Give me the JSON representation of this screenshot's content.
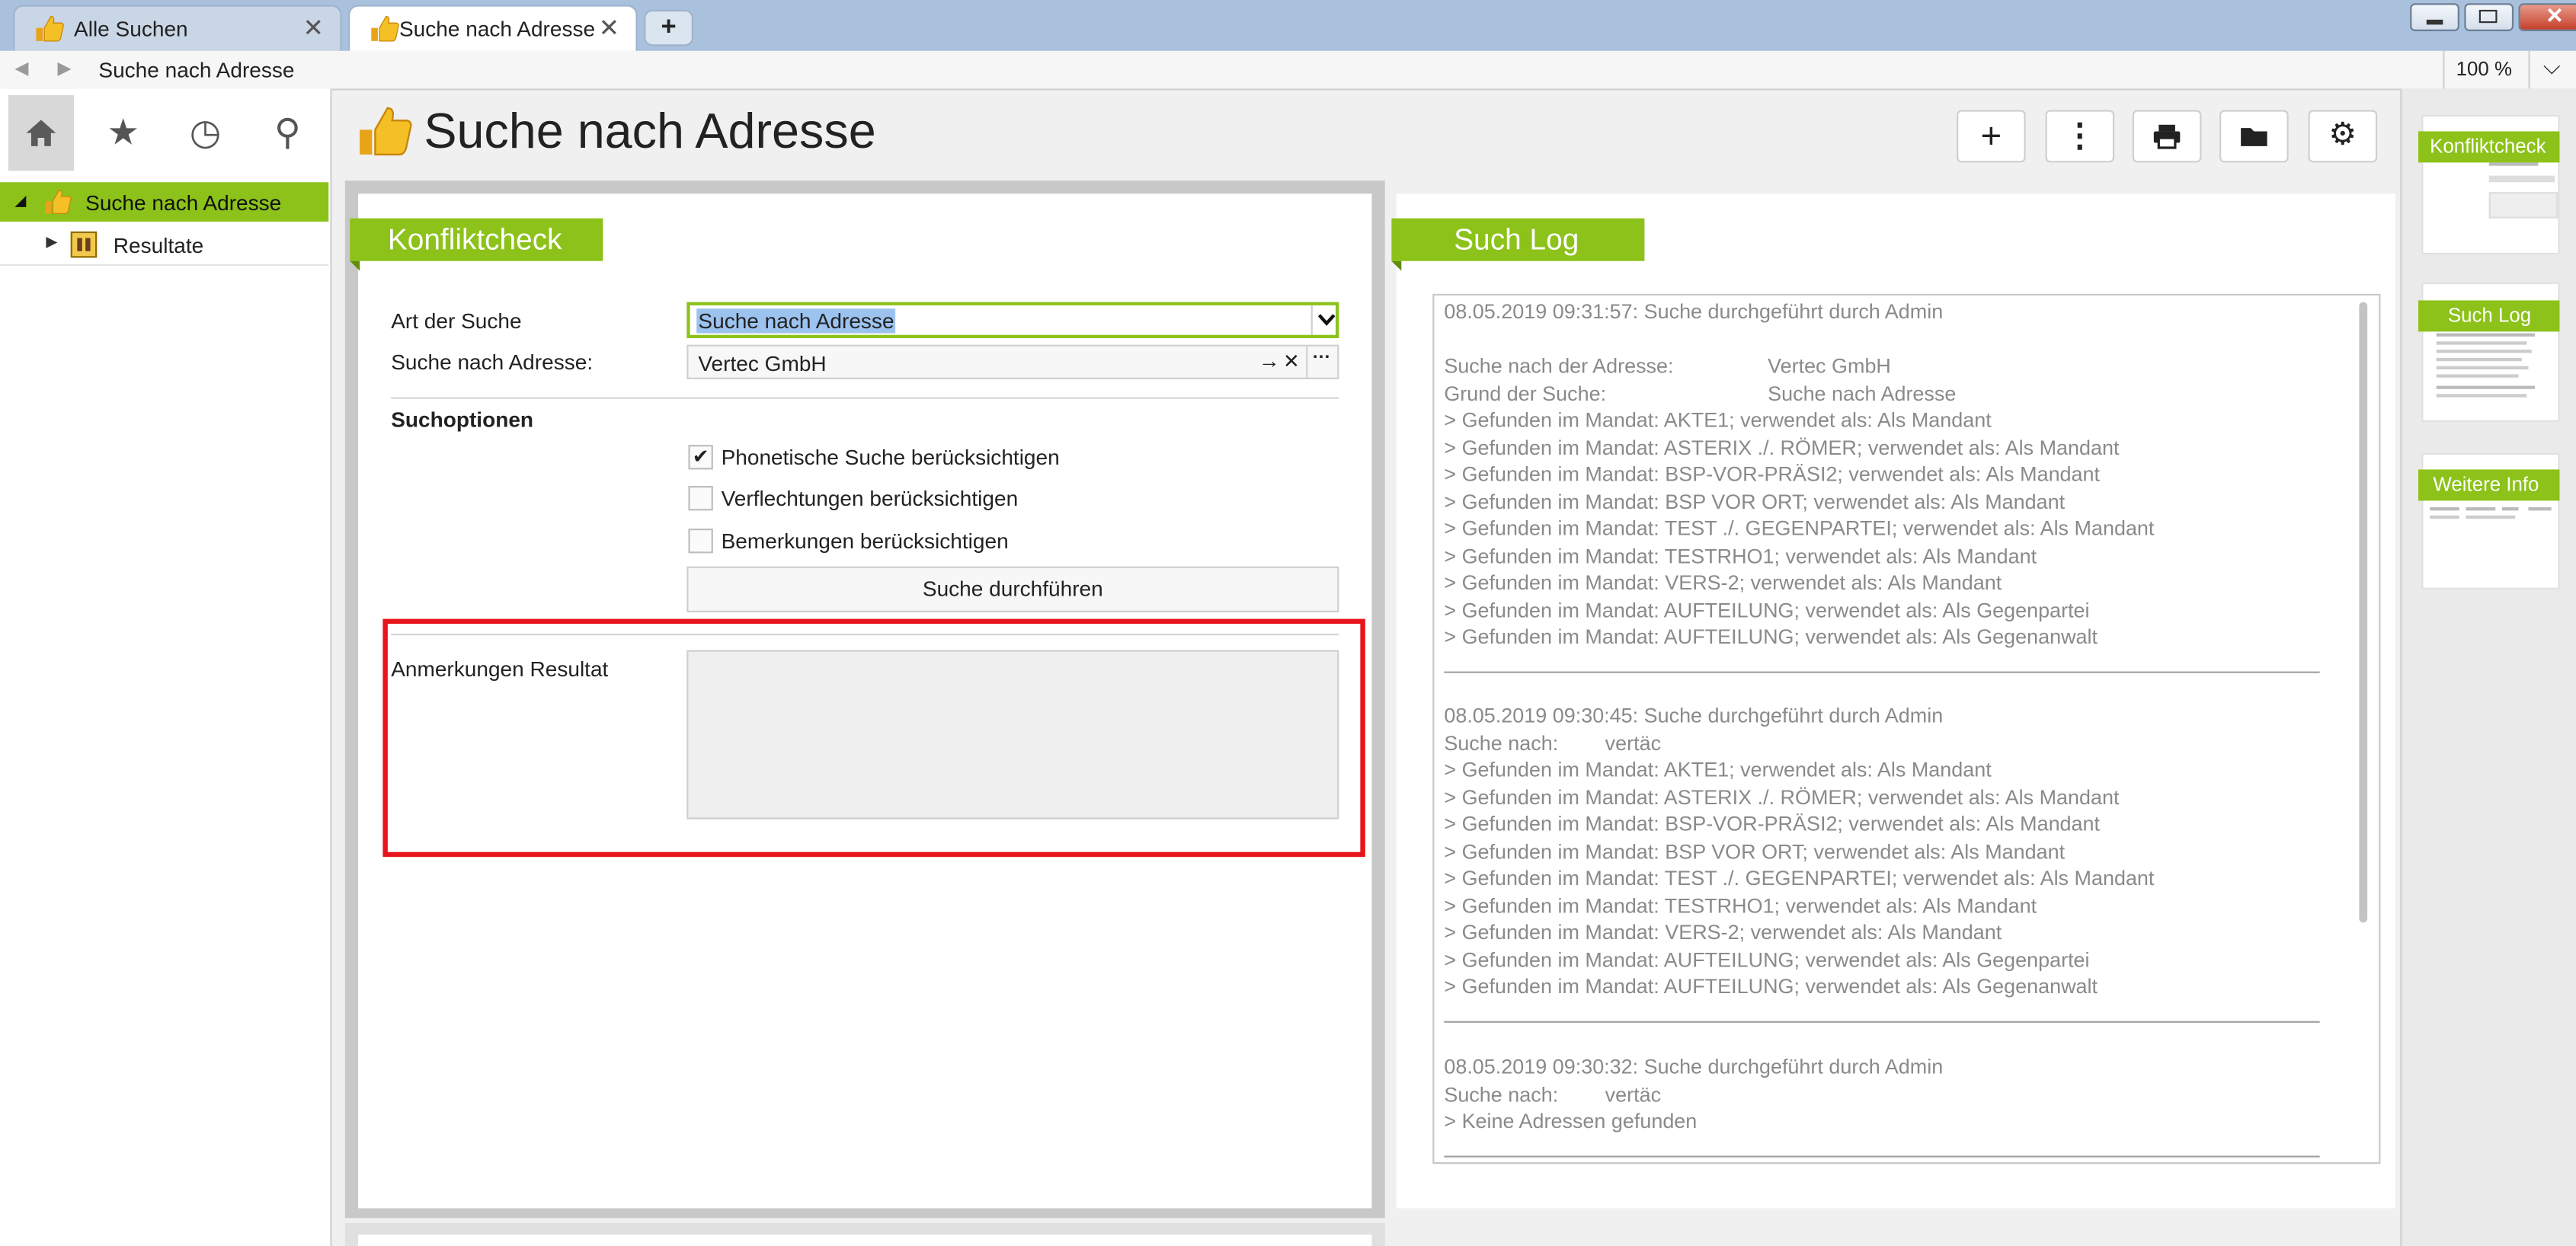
{
  "tabs": [
    {
      "label": "Alle Suchen",
      "close": "✕",
      "icon": "thumbs-up-icon"
    },
    {
      "label": "Suche nach Adresse",
      "close": "✕",
      "icon": "thumbs-up-icon"
    }
  ],
  "new_tab": "+",
  "address": {
    "back": "◀",
    "forward": "▶",
    "path": "Suche nach Adresse",
    "zoom": "100 %",
    "zoom_menu": "⌵"
  },
  "nav": {
    "home": "⌂",
    "favorites": "★",
    "history": "◷",
    "search": "⚲"
  },
  "tree": {
    "selected": {
      "label": "Suche nach Adresse",
      "arrow": "◢"
    },
    "child": {
      "label": "Resultate",
      "arrow": "▶"
    }
  },
  "header": {
    "title": "Suche nach Adresse"
  },
  "toolbar": {
    "add": "+",
    "more": "⋮",
    "print": "🖶",
    "folder": "▬",
    "settings": "⚙"
  },
  "konfliktcheck": {
    "title": "Konfliktcheck",
    "art_label": "Art der Suche",
    "art_value": "Suche nach Adresse",
    "adresse_label": "Suche nach Adresse:",
    "adresse_value": "Vertec GmbH",
    "adresse_goto": "→",
    "adresse_clear": "✕",
    "adresse_more": "···",
    "suchoptionen_label": "Suchoptionen",
    "options": [
      {
        "label": "Phonetische Suche berücksichtigen",
        "checked": "✔"
      },
      {
        "label": "Verflechtungen berücksichtigen",
        "checked": ""
      },
      {
        "label": "Bemerkungen berücksichtigen",
        "checked": ""
      }
    ],
    "search_button": "Suche durchführen",
    "anmerkungen_label": "Anmerkungen Resultat",
    "anmerkungen_value": ""
  },
  "suchlog": {
    "title": "Such Log",
    "entries": [
      {
        "header": "08.05.2019 09:31:57: Suche durchgeführt durch Admin",
        "fields": [
          {
            "k": "Suche nach der Adresse:",
            "v": "Vertec GmbH"
          },
          {
            "k": "Grund der Suche:",
            "v": "Suche nach Adresse"
          }
        ],
        "lines": [
          "> Gefunden im Mandat: AKTE1; verwendet als: Als Mandant",
          "> Gefunden im Mandat: ASTERIX ./. RÖMER; verwendet als: Als Mandant",
          "> Gefunden im Mandat: BSP-VOR-PRÄSI2; verwendet als: Als Mandant",
          "> Gefunden im Mandat: BSP VOR ORT; verwendet als: Als Mandant",
          "> Gefunden im Mandat: TEST ./. GEGENPARTEI; verwendet als: Als Mandant",
          "> Gefunden im Mandat: TESTRHO1; verwendet als: Als Mandant",
          "> Gefunden im Mandat: VERS-2; verwendet als: Als Mandant",
          "> Gefunden im Mandat: AUFTEILUNG; verwendet als: Als Gegenpartei",
          "> Gefunden im Mandat: AUFTEILUNG; verwendet als: Als Gegenanwalt"
        ]
      },
      {
        "header": "08.05.2019 09:30:45: Suche durchgeführt durch Admin",
        "fields": [
          {
            "k": "Suche nach:",
            "v": "vertäc"
          }
        ],
        "lines": [
          "> Gefunden im Mandat: AKTE1; verwendet als: Als Mandant",
          "> Gefunden im Mandat: ASTERIX ./. RÖMER; verwendet als: Als Mandant",
          "> Gefunden im Mandat: BSP-VOR-PRÄSI2; verwendet als: Als Mandant",
          "> Gefunden im Mandat: BSP VOR ORT; verwendet als: Als Mandant",
          "> Gefunden im Mandat: TEST ./. GEGENPARTEI; verwendet als: Als Mandant",
          "> Gefunden im Mandat: TESTRHO1; verwendet als: Als Mandant",
          "> Gefunden im Mandat: VERS-2; verwendet als: Als Mandant",
          "> Gefunden im Mandat: AUFTEILUNG; verwendet als: Als Gegenpartei",
          "> Gefunden im Mandat: AUFTEILUNG; verwendet als: Als Gegenanwalt"
        ]
      },
      {
        "header": "08.05.2019 09:30:32: Suche durchgeführt durch Admin",
        "fields": [
          {
            "k": "Suche nach:",
            "v": "vertäc"
          }
        ],
        "lines": [
          "> Keine Adressen gefunden"
        ]
      }
    ]
  },
  "thumbnails": [
    {
      "label": "Konfliktcheck"
    },
    {
      "label": "Such Log"
    },
    {
      "label": "Weitere Info"
    }
  ],
  "colors": {
    "accent_green": "#8cc21a",
    "highlight_red": "#e8141c",
    "selection_blue": "#9cc3ef"
  }
}
